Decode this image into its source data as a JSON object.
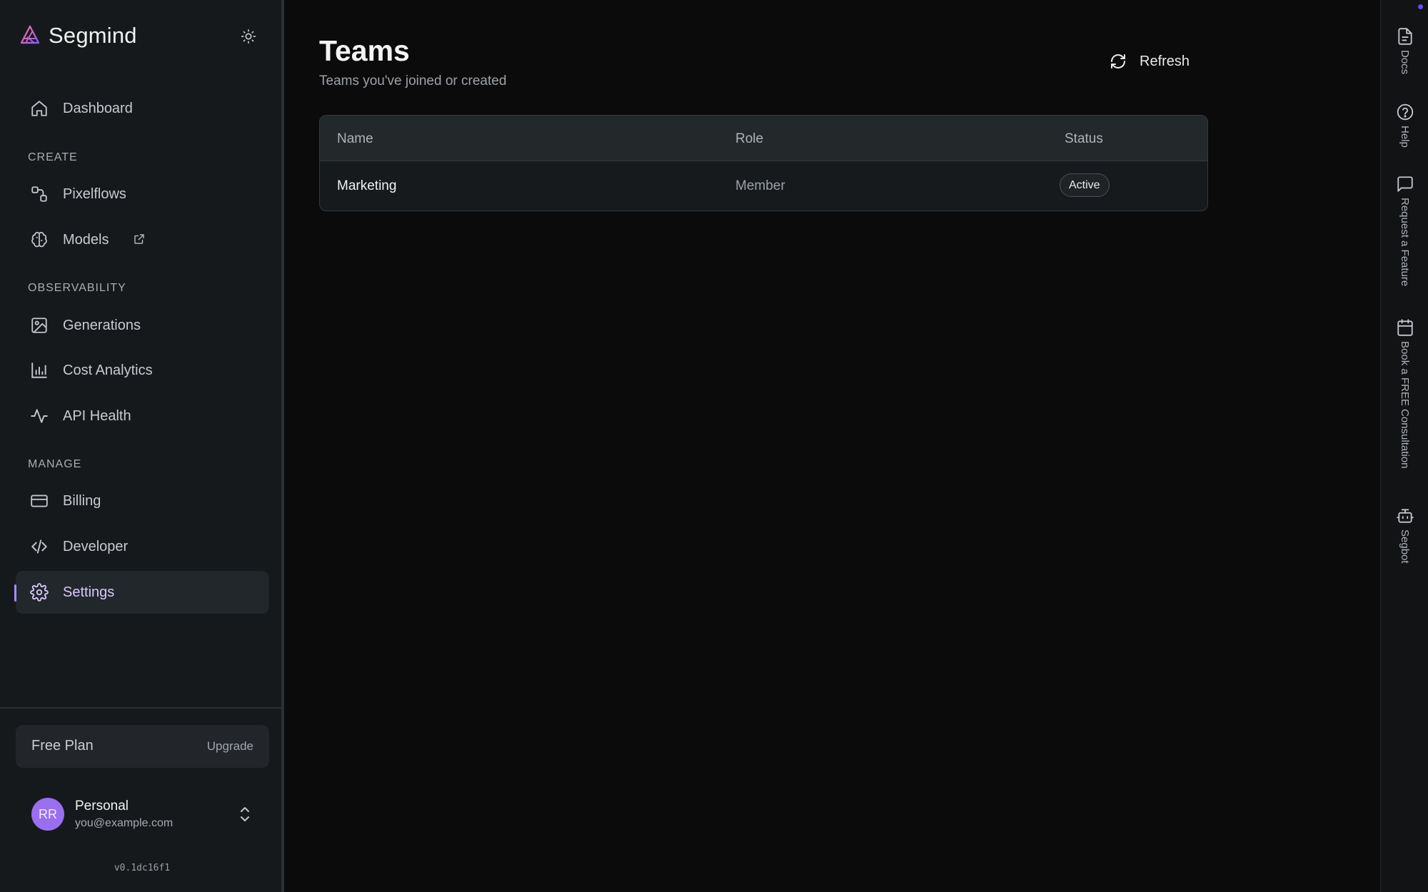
{
  "brand": {
    "name": "Segmind",
    "logo_icon": "segmind-logo-icon"
  },
  "sidebar": {
    "top_items": [
      {
        "label": "Dashboard",
        "icon": "home-icon"
      }
    ],
    "sections": [
      {
        "title": "CREATE",
        "items": [
          {
            "label": "Pixelflows",
            "icon": "workflow-icon"
          },
          {
            "label": "Models",
            "icon": "brain-icon",
            "external": true
          }
        ]
      },
      {
        "title": "OBSERVABILITY",
        "items": [
          {
            "label": "Generations",
            "icon": "image-icon"
          },
          {
            "label": "Cost Analytics",
            "icon": "bar-chart-icon"
          },
          {
            "label": "API Health",
            "icon": "activity-icon"
          }
        ]
      },
      {
        "title": "MANAGE",
        "items": [
          {
            "label": "Billing",
            "icon": "credit-card-icon"
          },
          {
            "label": "Developer",
            "icon": "code-icon"
          },
          {
            "label": "Settings",
            "icon": "gear-icon",
            "active": true
          }
        ]
      }
    ],
    "plan": {
      "name": "Free Plan",
      "upgrade_label": "Upgrade"
    },
    "user": {
      "initials": "RR",
      "name": "Personal",
      "email": "you@example.com"
    },
    "version": "v0.1dc16f1"
  },
  "page": {
    "title": "Teams",
    "subtitle": "Teams you've joined or created",
    "refresh_label": "Refresh"
  },
  "table": {
    "columns": [
      "Name",
      "Role",
      "Status"
    ],
    "rows": [
      {
        "name": "Marketing",
        "role": "Member",
        "status": "Active"
      }
    ]
  },
  "right_rail": [
    {
      "label": "Docs",
      "icon": "document-icon"
    },
    {
      "label": "Help",
      "icon": "help-circle-icon"
    },
    {
      "label": "Request a Feature",
      "icon": "message-square-icon"
    },
    {
      "label": "Book a FREE Consultation",
      "icon": "calendar-icon"
    },
    {
      "label": "Segbot",
      "icon": "bot-icon"
    }
  ],
  "colors": {
    "accent": "#a98bf0",
    "avatar": "#9a6ef0",
    "background": "#0b0b0b",
    "sidebar": "#16191b"
  }
}
